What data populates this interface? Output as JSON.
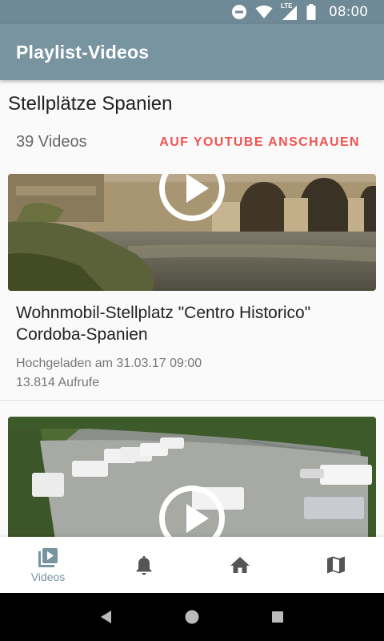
{
  "status_bar": {
    "time": "08:00",
    "lte_label": "LTE",
    "icons": [
      "do-not-disturb-icon",
      "wifi-icon",
      "signal-icon",
      "battery-icon"
    ]
  },
  "app_bar": {
    "title": "Playlist-Videos"
  },
  "playlist": {
    "title": "Stellplätze Spanien",
    "count": "39 Videos",
    "youtube_link": "AUF YOUTUBE ANSCHAUEN"
  },
  "videos": [
    {
      "title": "Wohnmobil-Stellplatz \"Centro Historico\" Cordoba-Spanien",
      "uploaded": "Hochgeladen am 31.03.17 09:00",
      "views": "13.814 Aufrufe"
    },
    {
      "title": "",
      "uploaded": "",
      "views": ""
    }
  ],
  "bottom_nav": {
    "items": [
      {
        "label": "Videos",
        "icon": "video-library-icon",
        "active": true
      },
      {
        "label": "",
        "icon": "bell-icon",
        "active": false
      },
      {
        "label": "",
        "icon": "home-icon",
        "active": false
      },
      {
        "label": "",
        "icon": "map-icon",
        "active": false
      }
    ]
  },
  "colors": {
    "primary": "#7894a0",
    "status_bar": "#6f8a96",
    "accent": "#f05350"
  }
}
